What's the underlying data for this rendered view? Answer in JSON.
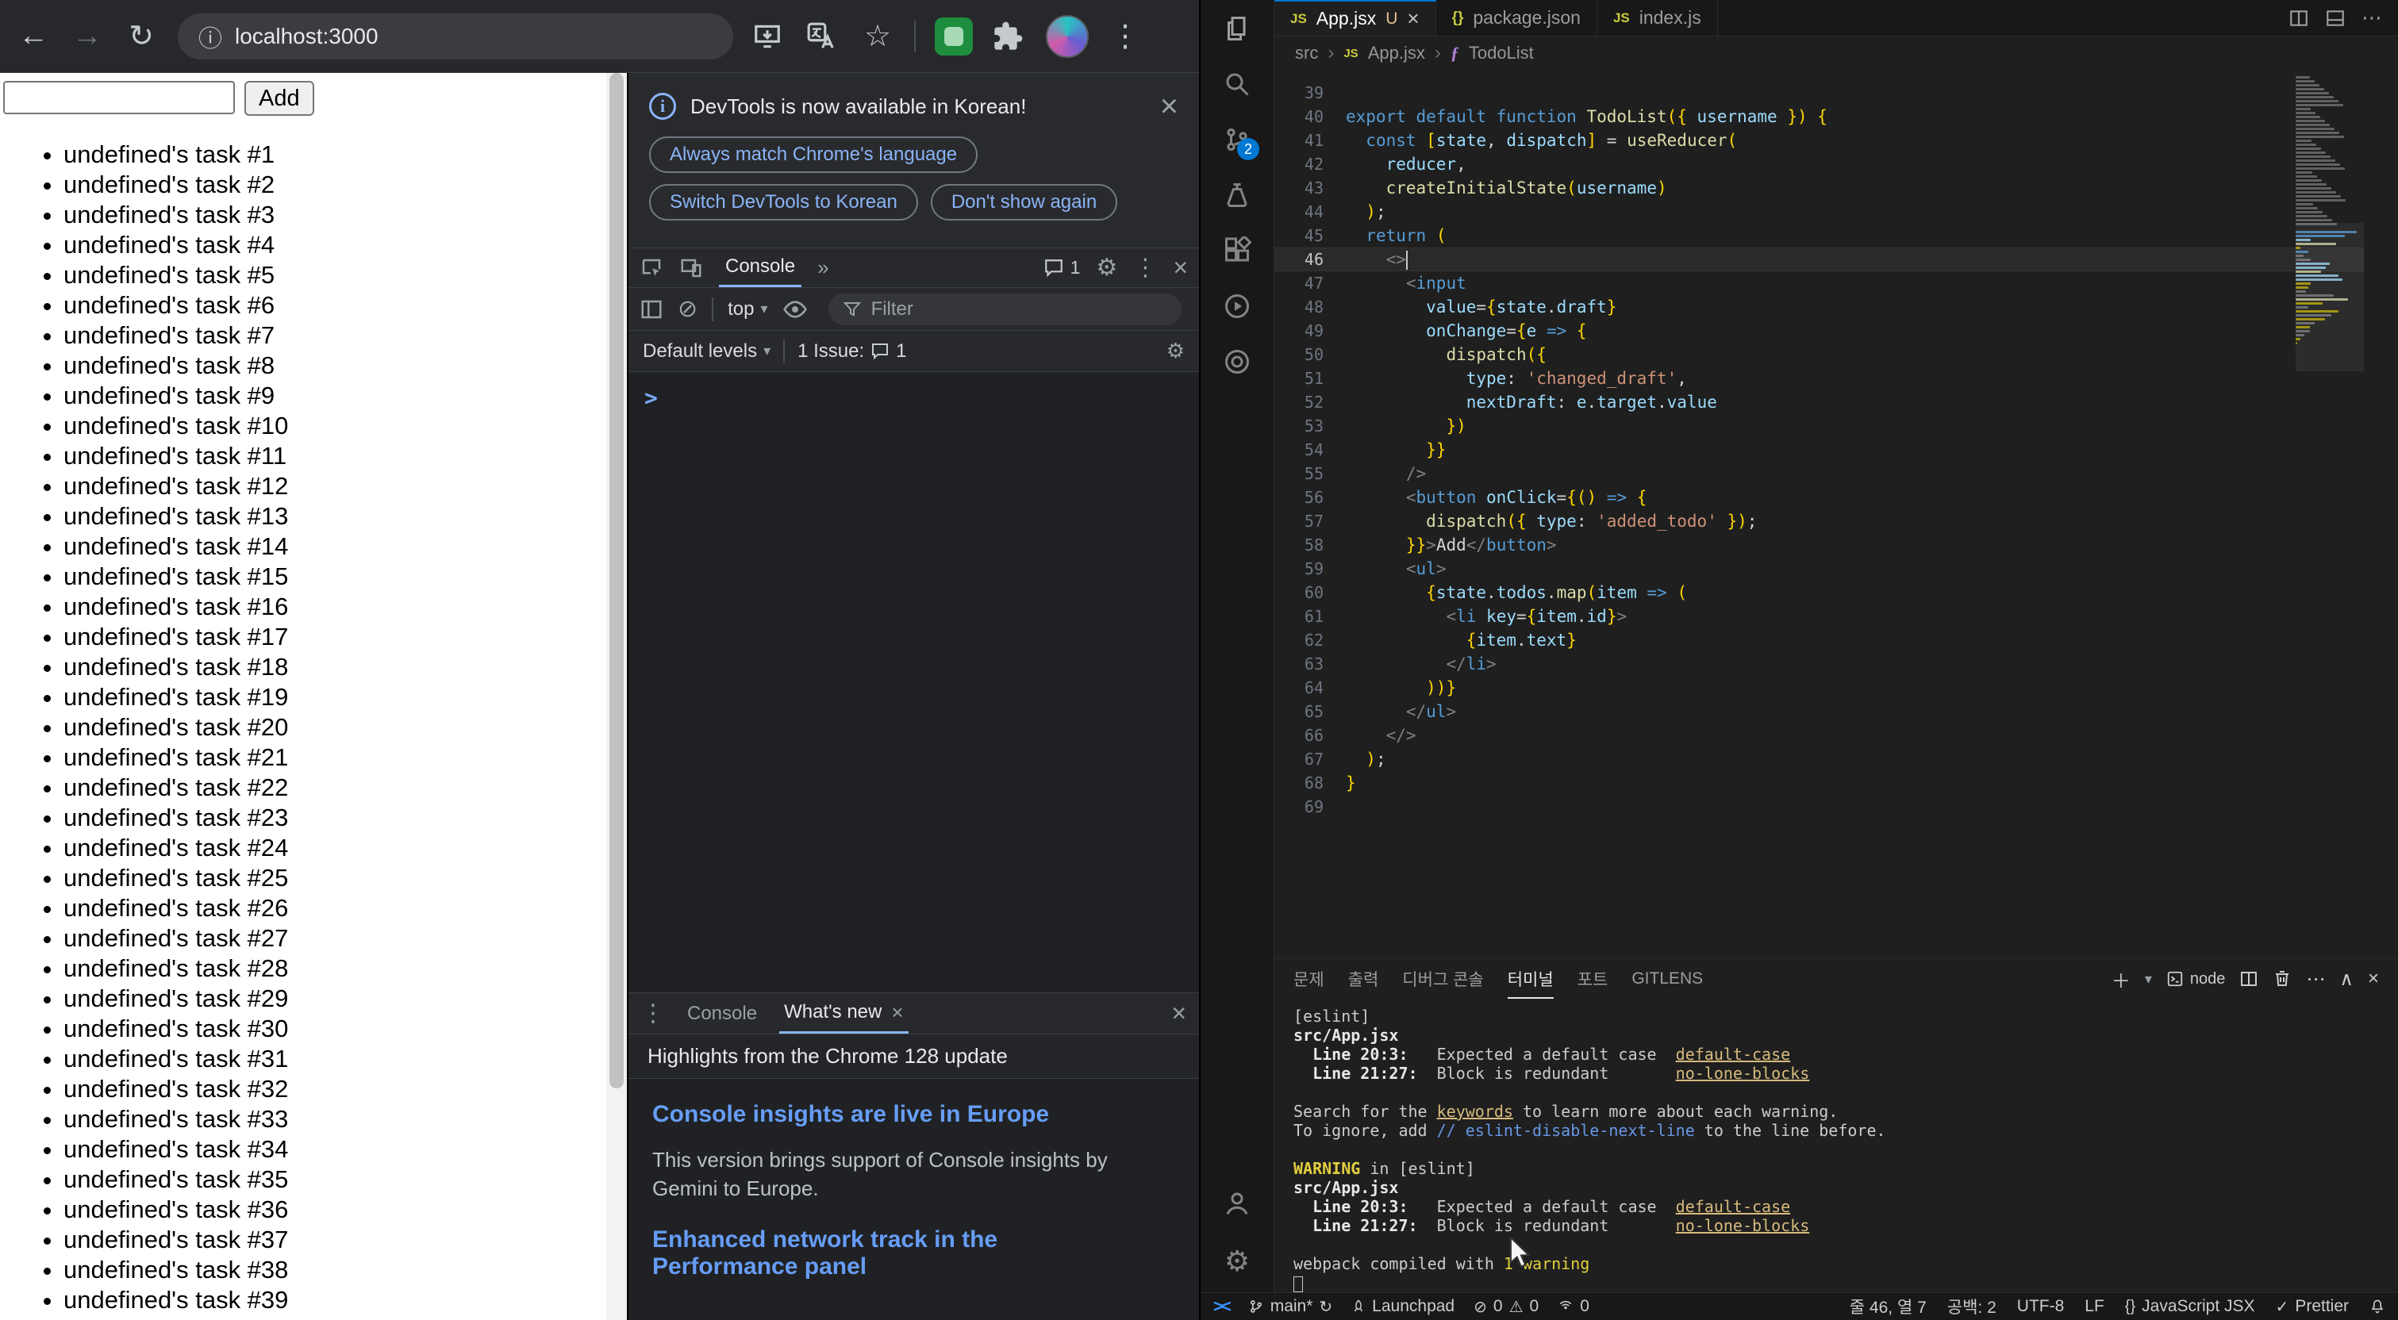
{
  "browser": {
    "toolbar": {
      "url": "localhost:3000"
    },
    "page": {
      "add_label": "Add",
      "todo_items": [
        "undefined's task #1",
        "undefined's task #2",
        "undefined's task #3",
        "undefined's task #4",
        "undefined's task #5",
        "undefined's task #6",
        "undefined's task #7",
        "undefined's task #8",
        "undefined's task #9",
        "undefined's task #10",
        "undefined's task #11",
        "undefined's task #12",
        "undefined's task #13",
        "undefined's task #14",
        "undefined's task #15",
        "undefined's task #16",
        "undefined's task #17",
        "undefined's task #18",
        "undefined's task #19",
        "undefined's task #20",
        "undefined's task #21",
        "undefined's task #22",
        "undefined's task #23",
        "undefined's task #24",
        "undefined's task #25",
        "undefined's task #26",
        "undefined's task #27",
        "undefined's task #28",
        "undefined's task #29",
        "undefined's task #30",
        "undefined's task #31",
        "undefined's task #32",
        "undefined's task #33",
        "undefined's task #34",
        "undefined's task #35",
        "undefined's task #36",
        "undefined's task #37",
        "undefined's task #38",
        "undefined's task #39"
      ]
    }
  },
  "devtools": {
    "notification": {
      "text": "DevTools is now available in Korean!",
      "button1": "Always match Chrome's language",
      "button2": "Switch DevTools to Korean",
      "button3": "Don't show again"
    },
    "toolbar": {
      "tab_console": "Console",
      "more_tabs": "»",
      "issues_count": "1"
    },
    "filter": {
      "context": "top",
      "placeholder": "Filter"
    },
    "levels": {
      "label": "Default levels",
      "issue_text": "1 Issue:",
      "issue_count": "1"
    },
    "drawer": {
      "tab_console": "Console",
      "tab_whats_new": "What's new",
      "header": "Highlights from the Chrome 128 update",
      "section1_title": "Console insights are live in Europe",
      "section1_body": "This version brings support of Console insights by Gemini to Europe.",
      "section2_title": "Enhanced network track in the Performance panel"
    }
  },
  "vscode": {
    "activity": {
      "scm_badge": "2"
    },
    "tabs": [
      {
        "label": "App.jsx",
        "git": "U"
      },
      {
        "label": "package.json"
      },
      {
        "label": "index.js"
      }
    ],
    "breadcrumb": {
      "p1": "src",
      "p2": "App.jsx",
      "p3": "TodoList"
    },
    "editor": {
      "current_line": 46,
      "lines": [
        {
          "n": 39,
          "t": []
        },
        {
          "n": 40,
          "t": [
            [
              "export default function ",
              "kw"
            ],
            [
              "TodoList",
              "fn"
            ],
            [
              "({ ",
              "g"
            ],
            [
              "username",
              "v"
            ],
            [
              " }) {",
              "g"
            ]
          ]
        },
        {
          "n": 41,
          "t": [
            [
              "  ",
              "d"
            ],
            [
              "const",
              "kw"
            ],
            [
              " ",
              "d"
            ],
            [
              "[",
              "g"
            ],
            [
              "state",
              "v"
            ],
            [
              ", ",
              "d"
            ],
            [
              "dispatch",
              "v"
            ],
            [
              "]",
              "g"
            ],
            [
              " = ",
              "d"
            ],
            [
              "useReducer",
              "fn"
            ],
            [
              "(",
              "g"
            ]
          ]
        },
        {
          "n": 42,
          "t": [
            [
              "    ",
              "d"
            ],
            [
              "reducer",
              "v"
            ],
            [
              ",",
              "d"
            ]
          ]
        },
        {
          "n": 43,
          "t": [
            [
              "    ",
              "d"
            ],
            [
              "createInitialState",
              "fn"
            ],
            [
              "(",
              "g"
            ],
            [
              "username",
              "v"
            ],
            [
              ")",
              "g"
            ]
          ]
        },
        {
          "n": 44,
          "t": [
            [
              "  ",
              "d"
            ],
            [
              ")",
              "g"
            ],
            [
              ";",
              "d"
            ]
          ]
        },
        {
          "n": 45,
          "t": [
            [
              "  ",
              "d"
            ],
            [
              "return",
              "kw"
            ],
            [
              " ",
              "d"
            ],
            [
              "(",
              "g"
            ]
          ]
        },
        {
          "n": 46,
          "t": [
            [
              "    ",
              "d"
            ],
            [
              "<>",
              "gr"
            ]
          ]
        },
        {
          "n": 47,
          "t": [
            [
              "      ",
              "d"
            ],
            [
              "<",
              "gr"
            ],
            [
              "input",
              "t"
            ]
          ]
        },
        {
          "n": 48,
          "t": [
            [
              "        ",
              "d"
            ],
            [
              "value",
              "v"
            ],
            [
              "=",
              "d"
            ],
            [
              "{",
              "g"
            ],
            [
              "state",
              "v"
            ],
            [
              ".",
              "d"
            ],
            [
              "draft",
              "v"
            ],
            [
              "}",
              "g"
            ]
          ]
        },
        {
          "n": 49,
          "t": [
            [
              "        ",
              "d"
            ],
            [
              "onChange",
              "v"
            ],
            [
              "=",
              "d"
            ],
            [
              "{",
              "g"
            ],
            [
              "e",
              "v"
            ],
            [
              " ",
              "d"
            ],
            [
              "=>",
              "kw"
            ],
            [
              " ",
              "d"
            ],
            [
              "{",
              "g"
            ]
          ]
        },
        {
          "n": 50,
          "t": [
            [
              "          ",
              "d"
            ],
            [
              "dispatch",
              "fn"
            ],
            [
              "({",
              "g"
            ]
          ]
        },
        {
          "n": 51,
          "t": [
            [
              "            ",
              "d"
            ],
            [
              "type",
              "v"
            ],
            [
              ": ",
              "d"
            ],
            [
              "'changed_draft'",
              "s"
            ],
            [
              ",",
              "d"
            ]
          ]
        },
        {
          "n": 52,
          "t": [
            [
              "            ",
              "d"
            ],
            [
              "nextDraft",
              "v"
            ],
            [
              ": ",
              "d"
            ],
            [
              "e",
              "v"
            ],
            [
              ".",
              "d"
            ],
            [
              "target",
              "v"
            ],
            [
              ".",
              "d"
            ],
            [
              "value",
              "v"
            ]
          ]
        },
        {
          "n": 53,
          "t": [
            [
              "          ",
              "d"
            ],
            [
              "})",
              "g"
            ]
          ]
        },
        {
          "n": 54,
          "t": [
            [
              "        ",
              "d"
            ],
            [
              "}}",
              "g"
            ]
          ]
        },
        {
          "n": 55,
          "t": [
            [
              "      ",
              "d"
            ],
            [
              "/>",
              "gr"
            ]
          ]
        },
        {
          "n": 56,
          "t": [
            [
              "      ",
              "d"
            ],
            [
              "<",
              "gr"
            ],
            [
              "button",
              "t"
            ],
            [
              " ",
              "d"
            ],
            [
              "onClick",
              "v"
            ],
            [
              "=",
              "d"
            ],
            [
              "{()",
              "g"
            ],
            [
              " ",
              "d"
            ],
            [
              "=>",
              "kw"
            ],
            [
              " ",
              "d"
            ],
            [
              "{",
              "g"
            ]
          ]
        },
        {
          "n": 57,
          "t": [
            [
              "        ",
              "d"
            ],
            [
              "dispatch",
              "fn"
            ],
            [
              "({ ",
              "g"
            ],
            [
              "type",
              "v"
            ],
            [
              ": ",
              "d"
            ],
            [
              "'added_todo'",
              "s"
            ],
            [
              " })",
              "g"
            ],
            [
              ";",
              "d"
            ]
          ]
        },
        {
          "n": 58,
          "t": [
            [
              "      ",
              "d"
            ],
            [
              "}}",
              "g"
            ],
            [
              ">",
              "gr"
            ],
            [
              "Add",
              "d"
            ],
            [
              "</",
              "gr"
            ],
            [
              "button",
              "t"
            ],
            [
              ">",
              "gr"
            ]
          ]
        },
        {
          "n": 59,
          "t": [
            [
              "      ",
              "d"
            ],
            [
              "<",
              "gr"
            ],
            [
              "ul",
              "t"
            ],
            [
              ">",
              "gr"
            ]
          ]
        },
        {
          "n": 60,
          "t": [
            [
              "        ",
              "d"
            ],
            [
              "{",
              "g"
            ],
            [
              "state",
              "v"
            ],
            [
              ".",
              "d"
            ],
            [
              "todos",
              "v"
            ],
            [
              ".",
              "d"
            ],
            [
              "map",
              "fn"
            ],
            [
              "(",
              "g"
            ],
            [
              "item",
              "v"
            ],
            [
              " ",
              "d"
            ],
            [
              "=>",
              "kw"
            ],
            [
              " ",
              "d"
            ],
            [
              "(",
              "g"
            ]
          ]
        },
        {
          "n": 61,
          "t": [
            [
              "          ",
              "d"
            ],
            [
              "<",
              "gr"
            ],
            [
              "li",
              "t"
            ],
            [
              " ",
              "d"
            ],
            [
              "key",
              "v"
            ],
            [
              "=",
              "d"
            ],
            [
              "{",
              "g"
            ],
            [
              "item",
              "v"
            ],
            [
              ".",
              "d"
            ],
            [
              "id",
              "v"
            ],
            [
              "}",
              "g"
            ],
            [
              ">",
              "gr"
            ]
          ]
        },
        {
          "n": 62,
          "t": [
            [
              "            ",
              "d"
            ],
            [
              "{",
              "g"
            ],
            [
              "item",
              "v"
            ],
            [
              ".",
              "d"
            ],
            [
              "text",
              "v"
            ],
            [
              "}",
              "g"
            ]
          ]
        },
        {
          "n": 63,
          "t": [
            [
              "          ",
              "d"
            ],
            [
              "</",
              "gr"
            ],
            [
              "li",
              "t"
            ],
            [
              ">",
              "gr"
            ]
          ]
        },
        {
          "n": 64,
          "t": [
            [
              "        ",
              "d"
            ],
            [
              "))}",
              "g"
            ]
          ]
        },
        {
          "n": 65,
          "t": [
            [
              "      ",
              "d"
            ],
            [
              "</",
              "gr"
            ],
            [
              "ul",
              "t"
            ],
            [
              ">",
              "gr"
            ]
          ]
        },
        {
          "n": 66,
          "t": [
            [
              "    ",
              "d"
            ],
            [
              "</>",
              "gr"
            ]
          ]
        },
        {
          "n": 67,
          "t": [
            [
              "  ",
              "d"
            ],
            [
              ")",
              "g"
            ],
            [
              ";",
              "d"
            ]
          ]
        },
        {
          "n": 68,
          "t": [
            [
              "}",
              "g"
            ]
          ]
        },
        {
          "n": 69,
          "t": []
        }
      ]
    },
    "panel": {
      "tabs": [
        "문제",
        "출력",
        "디버그 콘솔",
        "터미널",
        "포트",
        "GITLENS"
      ],
      "active_tab": "터미널",
      "node_label": "node",
      "terminal": [
        [
          [
            "[eslint]",
            "d"
          ]
        ],
        [
          [
            "src/App.jsx",
            "b"
          ]
        ],
        [
          [
            "  ",
            "d"
          ],
          [
            "Line 20:3:",
            "b"
          ],
          [
            "   Expected a default case  ",
            "d"
          ],
          [
            "default-case",
            "y"
          ]
        ],
        [
          [
            "  ",
            "d"
          ],
          [
            "Line 21:27:",
            "b"
          ],
          [
            "  Block is redundant       ",
            "d"
          ],
          [
            "no-lone-blocks",
            "y"
          ]
        ],
        [],
        [
          [
            "Search for the ",
            "d"
          ],
          [
            "keywords",
            "y"
          ],
          [
            " to learn more about each warning.",
            "d"
          ]
        ],
        [
          [
            "To ignore, add ",
            "d"
          ],
          [
            "// eslint-disable-next-line",
            "bl"
          ],
          [
            " to the line before.",
            "d"
          ]
        ],
        [],
        [
          [
            "WARNING",
            "ywb"
          ],
          [
            " in [eslint]",
            "d"
          ]
        ],
        [
          [
            "src/App.jsx",
            "b"
          ]
        ],
        [
          [
            "  ",
            "d"
          ],
          [
            "Line 20:3:",
            "b"
          ],
          [
            "   Expected a default case  ",
            "d"
          ],
          [
            "default-case",
            "y"
          ]
        ],
        [
          [
            "  ",
            "d"
          ],
          [
            "Line 21:27:",
            "b"
          ],
          [
            "  Block is redundant       ",
            "d"
          ],
          [
            "no-lone-blocks",
            "y"
          ]
        ],
        [],
        [
          [
            "webpack compiled with ",
            "d"
          ],
          [
            "1 warning",
            "yw"
          ]
        ],
        [
          [
            "",
            "cur"
          ]
        ]
      ]
    },
    "status": {
      "branch": "main*",
      "launchpad": "Launchpad",
      "errors": "0",
      "warnings": "0",
      "ports": "0",
      "cursor": "줄 46, 열 7",
      "indent": "공백: 2",
      "encoding": "UTF-8",
      "eol": "LF",
      "language": "JavaScript JSX",
      "formatter": "Prettier"
    }
  }
}
